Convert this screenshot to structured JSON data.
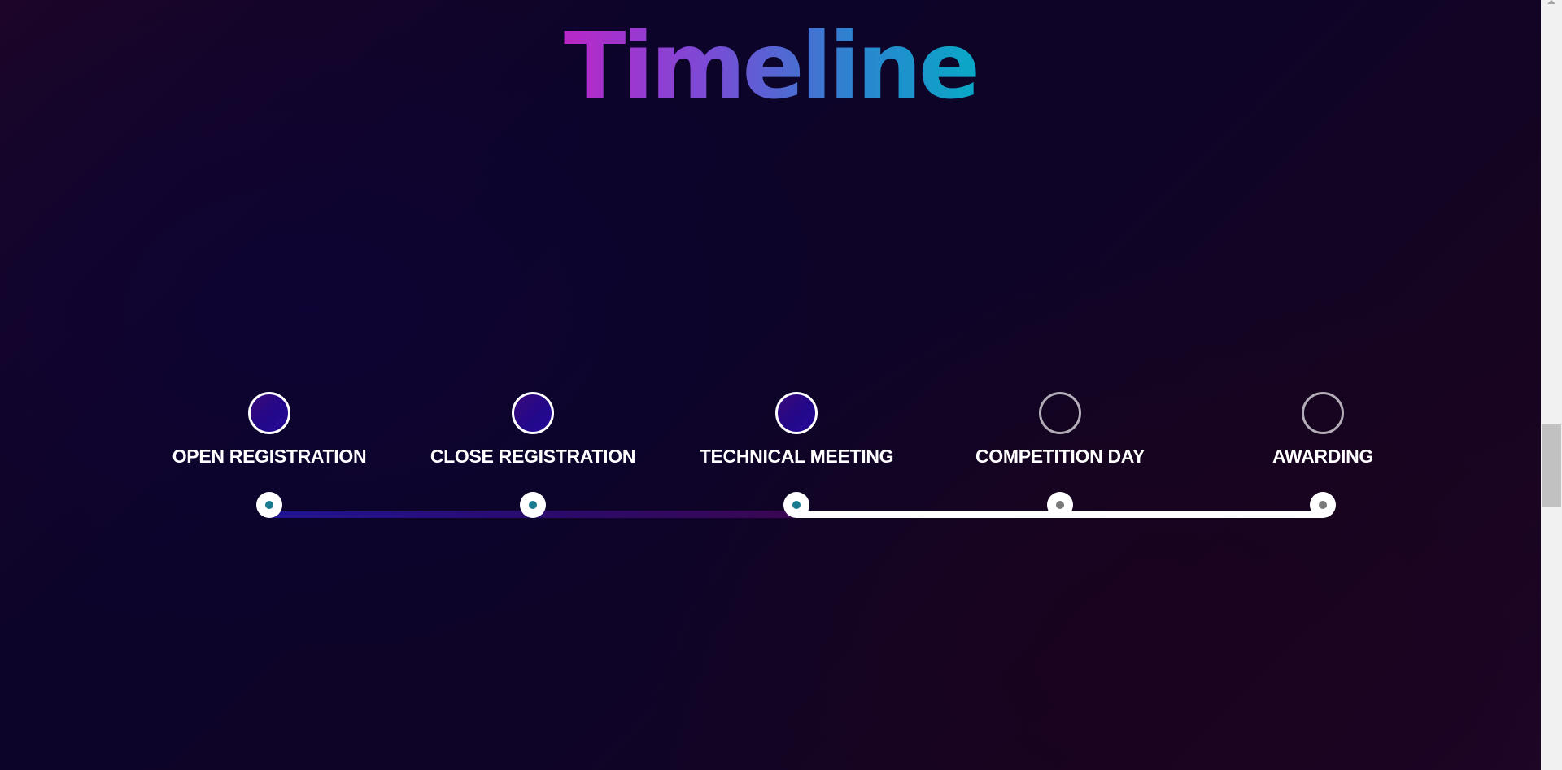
{
  "page": {
    "title": "Timeline"
  },
  "timeline": {
    "steps": [
      {
        "label": "OPEN REGISTRATION",
        "status": "done"
      },
      {
        "label": "CLOSE REGISTRATION",
        "status": "done"
      },
      {
        "label": "TECHNICAL MEETING",
        "status": "done"
      },
      {
        "label": "COMPETITION DAY",
        "status": "pending"
      },
      {
        "label": "AWARDING",
        "status": "pending"
      }
    ],
    "colors": {
      "title_gradient_start": "#b927c8",
      "title_gradient_end": "#09a8c6",
      "done_fill": "#22088a",
      "done_dot": "#1b7b8e",
      "pending_dot": "#7a7a7a",
      "pending_border": "#b3adb8"
    }
  }
}
